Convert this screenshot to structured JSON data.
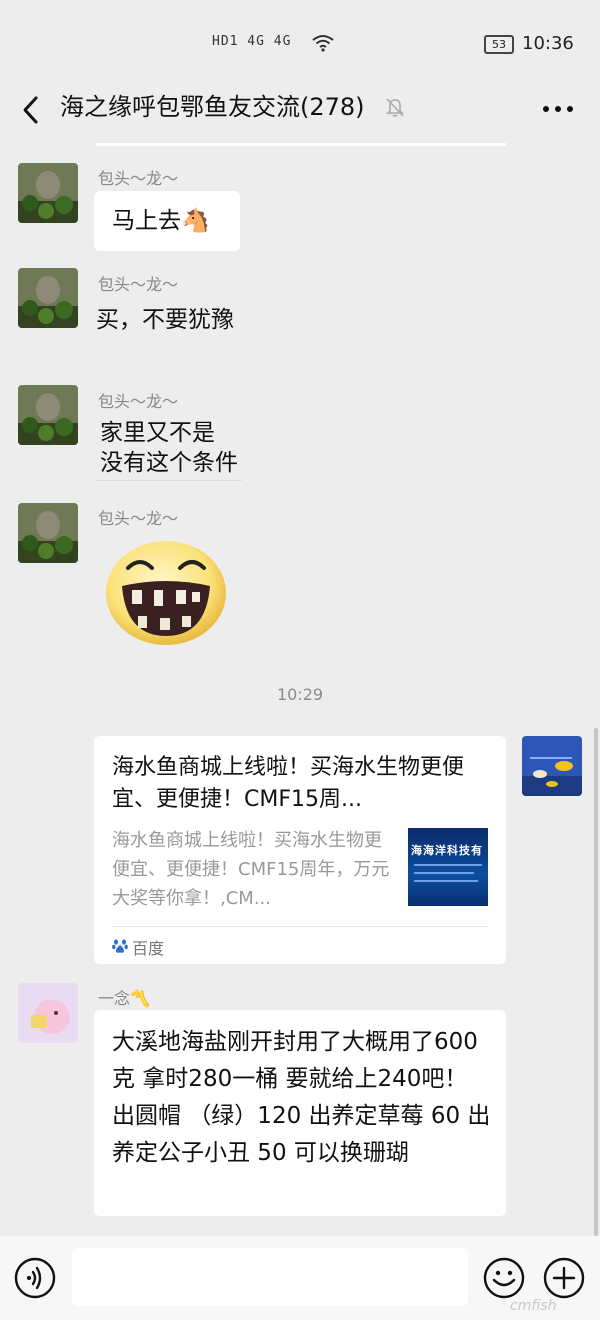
{
  "status_bar": {
    "network": "HD1 4G 4G",
    "battery": "53",
    "time": "10:36"
  },
  "header": {
    "title": "海之缘呼包鄂鱼友交流(278)"
  },
  "messages": [
    {
      "sender": "包头～龙～",
      "text": "马上去🐴"
    },
    {
      "sender": "包头～龙～",
      "text": "买，不要犹豫"
    },
    {
      "sender": "包头～龙～",
      "lines": [
        "家里又不是",
        "没有这个条件"
      ]
    },
    {
      "sender": "包头～龙～"
    }
  ],
  "time_label": "10:29",
  "link_card": {
    "title": "海水鱼商城上线啦！买海水生物更便宜、更便捷！CMF15周...",
    "description": "海水鱼商城上线啦！买海水生物更便宜、更便捷！CMF15周年，万元大奖等你拿！,CM...",
    "thumb_text": "海海洋科技有",
    "source": "百度"
  },
  "last_message": {
    "sender": "一念〽️",
    "text": "大溪地海盐刚开封用了大概用了600克 拿时280一桶  要就给上240吧！ 出圆帽 （绿）120   出养定草莓 60 出养定公子小丑 50   可以换珊瑚"
  },
  "input": {
    "placeholder": ""
  },
  "watermark": "cmfish",
  "colors": {
    "background": "#ededed",
    "bubble": "#ffffff",
    "link_blue": "#2b6fd6"
  }
}
